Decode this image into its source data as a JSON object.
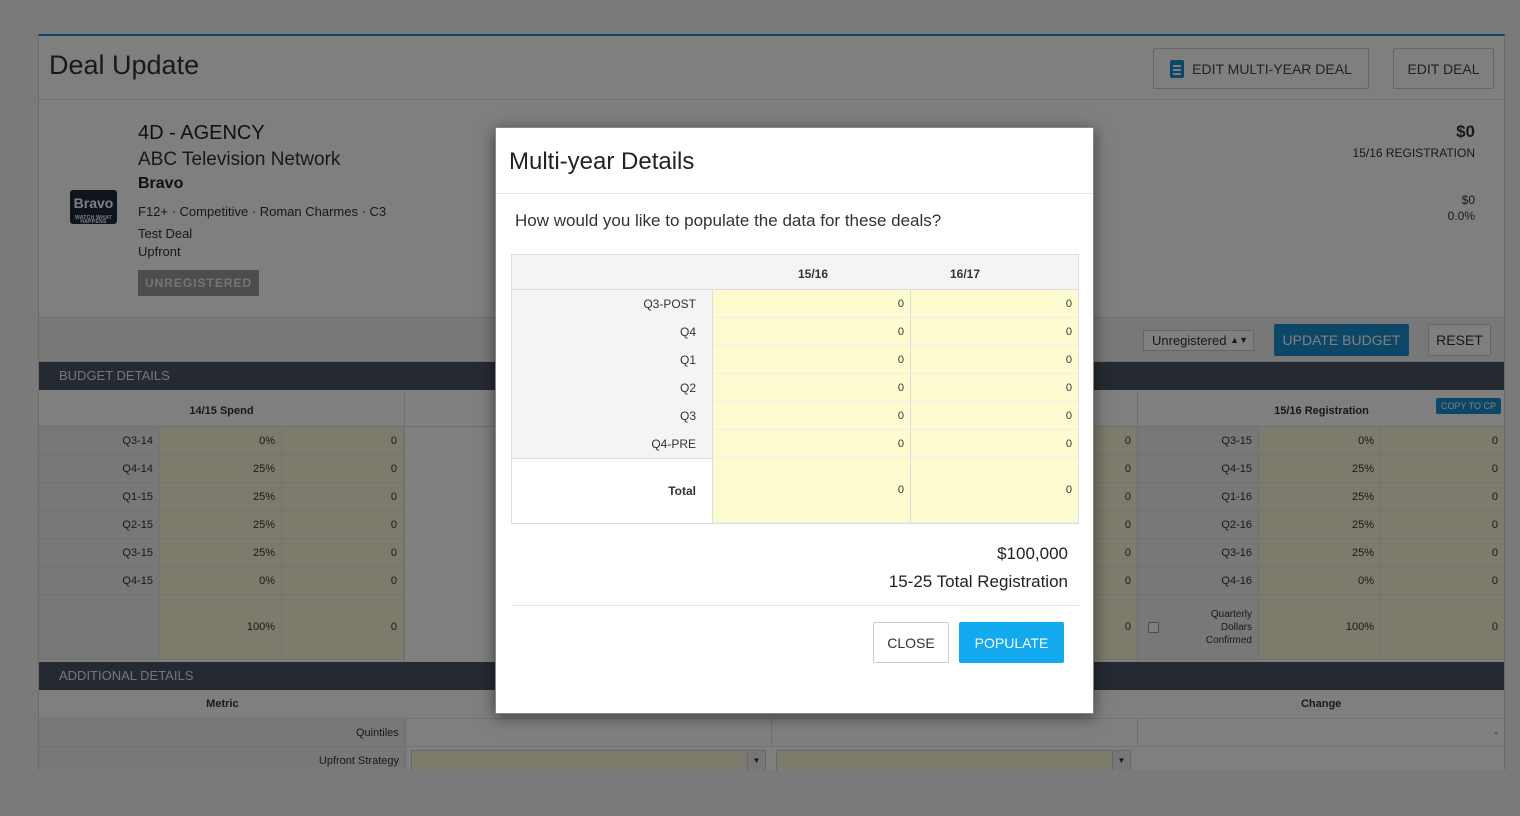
{
  "page": {
    "title": "Deal Update",
    "edit_multi_year_label": "EDIT MULTI-YEAR DEAL",
    "edit_deal_label": "EDIT DEAL"
  },
  "deal": {
    "agency": "4D - AGENCY",
    "network": "ABC Television Network",
    "channel": "Bravo",
    "logo_text": "Bravo",
    "logo_sub": "WATCH WHAT HAPPENS",
    "meta": "F12+ · Competitive · Roman Charmes · C3",
    "deal_name": "Test Deal",
    "type": "Upfront",
    "status_badge": "UNREGISTERED",
    "registration_amount": "$0",
    "registration_label": "15/16 REGISTRATION",
    "secondary_amount": "$0",
    "secondary_pct": "0.0%"
  },
  "toolbar": {
    "status_select": "Unregistered",
    "update_budget_label": "UPDATE BUDGET",
    "reset_label": "RESET"
  },
  "budget": {
    "section_title": "BUDGET DETAILS",
    "left_header": "14/15 Spend",
    "right_header": "15/16 Registration",
    "copy_label": "COPY TO CP",
    "left_rows": [
      {
        "q": "Q3-14",
        "pct": "0%",
        "val": "0"
      },
      {
        "q": "Q4-14",
        "pct": "25%",
        "val": "0"
      },
      {
        "q": "Q1-15",
        "pct": "25%",
        "val": "0"
      },
      {
        "q": "Q2-15",
        "pct": "25%",
        "val": "0"
      },
      {
        "q": "Q3-15",
        "pct": "25%",
        "val": "0"
      },
      {
        "q": "Q4-15",
        "pct": "0%",
        "val": "0"
      }
    ],
    "left_total": {
      "pct": "100%",
      "val": "0"
    },
    "right_rows": [
      {
        "q": "Q3-15",
        "pct": "0%",
        "val": "0"
      },
      {
        "q": "Q4-15",
        "pct": "25%",
        "val": "0"
      },
      {
        "q": "Q1-16",
        "pct": "25%",
        "val": "0"
      },
      {
        "q": "Q2-16",
        "pct": "25%",
        "val": "0"
      },
      {
        "q": "Q3-16",
        "pct": "25%",
        "val": "0"
      },
      {
        "q": "Q4-16",
        "pct": "0%",
        "val": "0"
      }
    ],
    "right_total": {
      "label": "Quarterly Dollars Confirmed",
      "pct": "100%",
      "val": "0"
    },
    "middle_right_vals": [
      "0",
      "0",
      "0",
      "0",
      "0",
      "0",
      "0"
    ]
  },
  "additional": {
    "section_title": "ADDITIONAL DETAILS",
    "metric_header": "Metric",
    "change_header": "Change",
    "rows": [
      {
        "label": "Quintiles",
        "change": "-"
      },
      {
        "label": "Upfront Strategy",
        "change": ""
      }
    ]
  },
  "modal": {
    "title": "Multi-year Details",
    "question": "How would you like to populate the data for these deals?",
    "columns": [
      "15/16",
      "16/17"
    ],
    "rows": [
      {
        "label": "Q3-POST",
        "v1": "0",
        "v2": "0"
      },
      {
        "label": "Q4",
        "v1": "0",
        "v2": "0"
      },
      {
        "label": "Q1",
        "v1": "0",
        "v2": "0"
      },
      {
        "label": "Q2",
        "v1": "0",
        "v2": "0"
      },
      {
        "label": "Q3",
        "v1": "0",
        "v2": "0"
      },
      {
        "label": "Q4-PRE",
        "v1": "0",
        "v2": "0"
      }
    ],
    "total": {
      "label": "Total",
      "v1": "0",
      "v2": "0"
    },
    "amount": "$100,000",
    "registration_label": "15-25 Total Registration",
    "close_label": "CLOSE",
    "populate_label": "POPULATE"
  }
}
